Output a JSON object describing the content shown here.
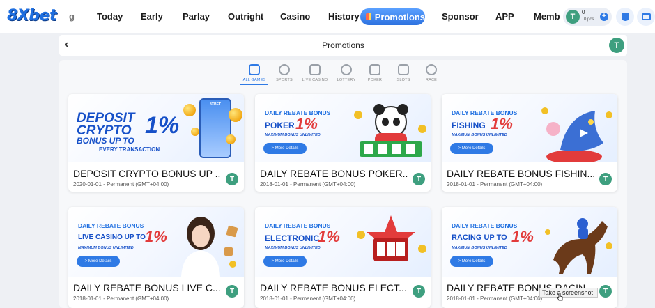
{
  "brand": {
    "logo_text": "8Xbet",
    "accent": "#2f7ae5",
    "avatar_color": "#3e9f7f"
  },
  "nav": {
    "cut_item": "g",
    "items": [
      "Today",
      "Early",
      "Parlay",
      "Outright",
      "Casino",
      "History"
    ],
    "active": "Promotions",
    "items_after": [
      "Sponsor",
      "APP",
      "Memb"
    ]
  },
  "user": {
    "avatar_letter": "T",
    "balance": "0",
    "points": "0 pcs",
    "plus": "+"
  },
  "header": {
    "back_glyph": "‹",
    "title": "Promotions",
    "avatar_letter": "T"
  },
  "categories": [
    {
      "label": "ALL GAMES",
      "icon": "grid-icon",
      "active": true
    },
    {
      "label": "SPORTS",
      "icon": "ball-icon",
      "active": false
    },
    {
      "label": "LIVE CASINO",
      "icon": "card-icon",
      "active": false
    },
    {
      "label": "LOTTERY",
      "icon": "lottery-icon",
      "active": false
    },
    {
      "label": "POKER",
      "icon": "poker-icon",
      "active": false
    },
    {
      "label": "SLOTS",
      "icon": "slots-icon",
      "active": false
    },
    {
      "label": "RACE",
      "icon": "horse-icon",
      "active": false
    }
  ],
  "promos": [
    {
      "banner": {
        "l1": "DEPOSIT",
        "l2": "CRYPTO",
        "l3": "BONUS UP TO",
        "pct": "1%",
        "l4": "EVERY TRANSACTION",
        "phone_brand": "8XBET"
      },
      "title": "DEPOSIT CRYPTO BONUS UP ...",
      "date": "2020-01-01 - Permanent (GMT+04:00)"
    },
    {
      "banner": {
        "head": "DAILY REBATE BONUS",
        "game": "POKER",
        "pct": "1%",
        "max": "MAXIMUM BONUS UNLIMITED",
        "btn": "> More Details"
      },
      "title": "DAILY REBATE BONUS POKER...",
      "date": "2018-01-01 - Permanent (GMT+04:00)"
    },
    {
      "banner": {
        "head": "DAILY REBATE BONUS",
        "game": "FISHING",
        "pct": "1%",
        "max": "MAXIMUM BONUS UNLIMITED",
        "btn": "> More Details"
      },
      "title": "DAILY REBATE BONUS FISHIN...",
      "date": "2018-01-01 - Permanent (GMT+04:00)"
    },
    {
      "banner": {
        "head": "DAILY REBATE BONUS",
        "game": "LIVE CASINO UP TO",
        "pct": "1%",
        "max": "MAXIMUM BONUS UNLIMITED",
        "btn": "> More Details"
      },
      "title": "DAILY REBATE BONUS LIVE C...",
      "date": "2018-01-01 - Permanent (GMT+04:00)"
    },
    {
      "banner": {
        "head": "DAILY REBATE BONUS",
        "game": "ELECTRONIC",
        "pct": "1%",
        "max": "MAXIMUM BONUS UNLIMITED",
        "btn": "> More Details"
      },
      "title": "DAILY REBATE BONUS ELECT...",
      "date": "2018-01-01 - Permanent (GMT+04:00)"
    },
    {
      "banner": {
        "head": "DAILY REBATE BONUS",
        "game": "RACING UP TO",
        "pct": "1%",
        "max": "MAXIMUM BONUS UNLIMITED",
        "btn": "> More Details"
      },
      "title": "DAILY REBATE BONUS RACIN...",
      "date": "2018-01-01 - Permanent (GMT+04:00)"
    }
  ],
  "tooltip": "Take a screenshot"
}
